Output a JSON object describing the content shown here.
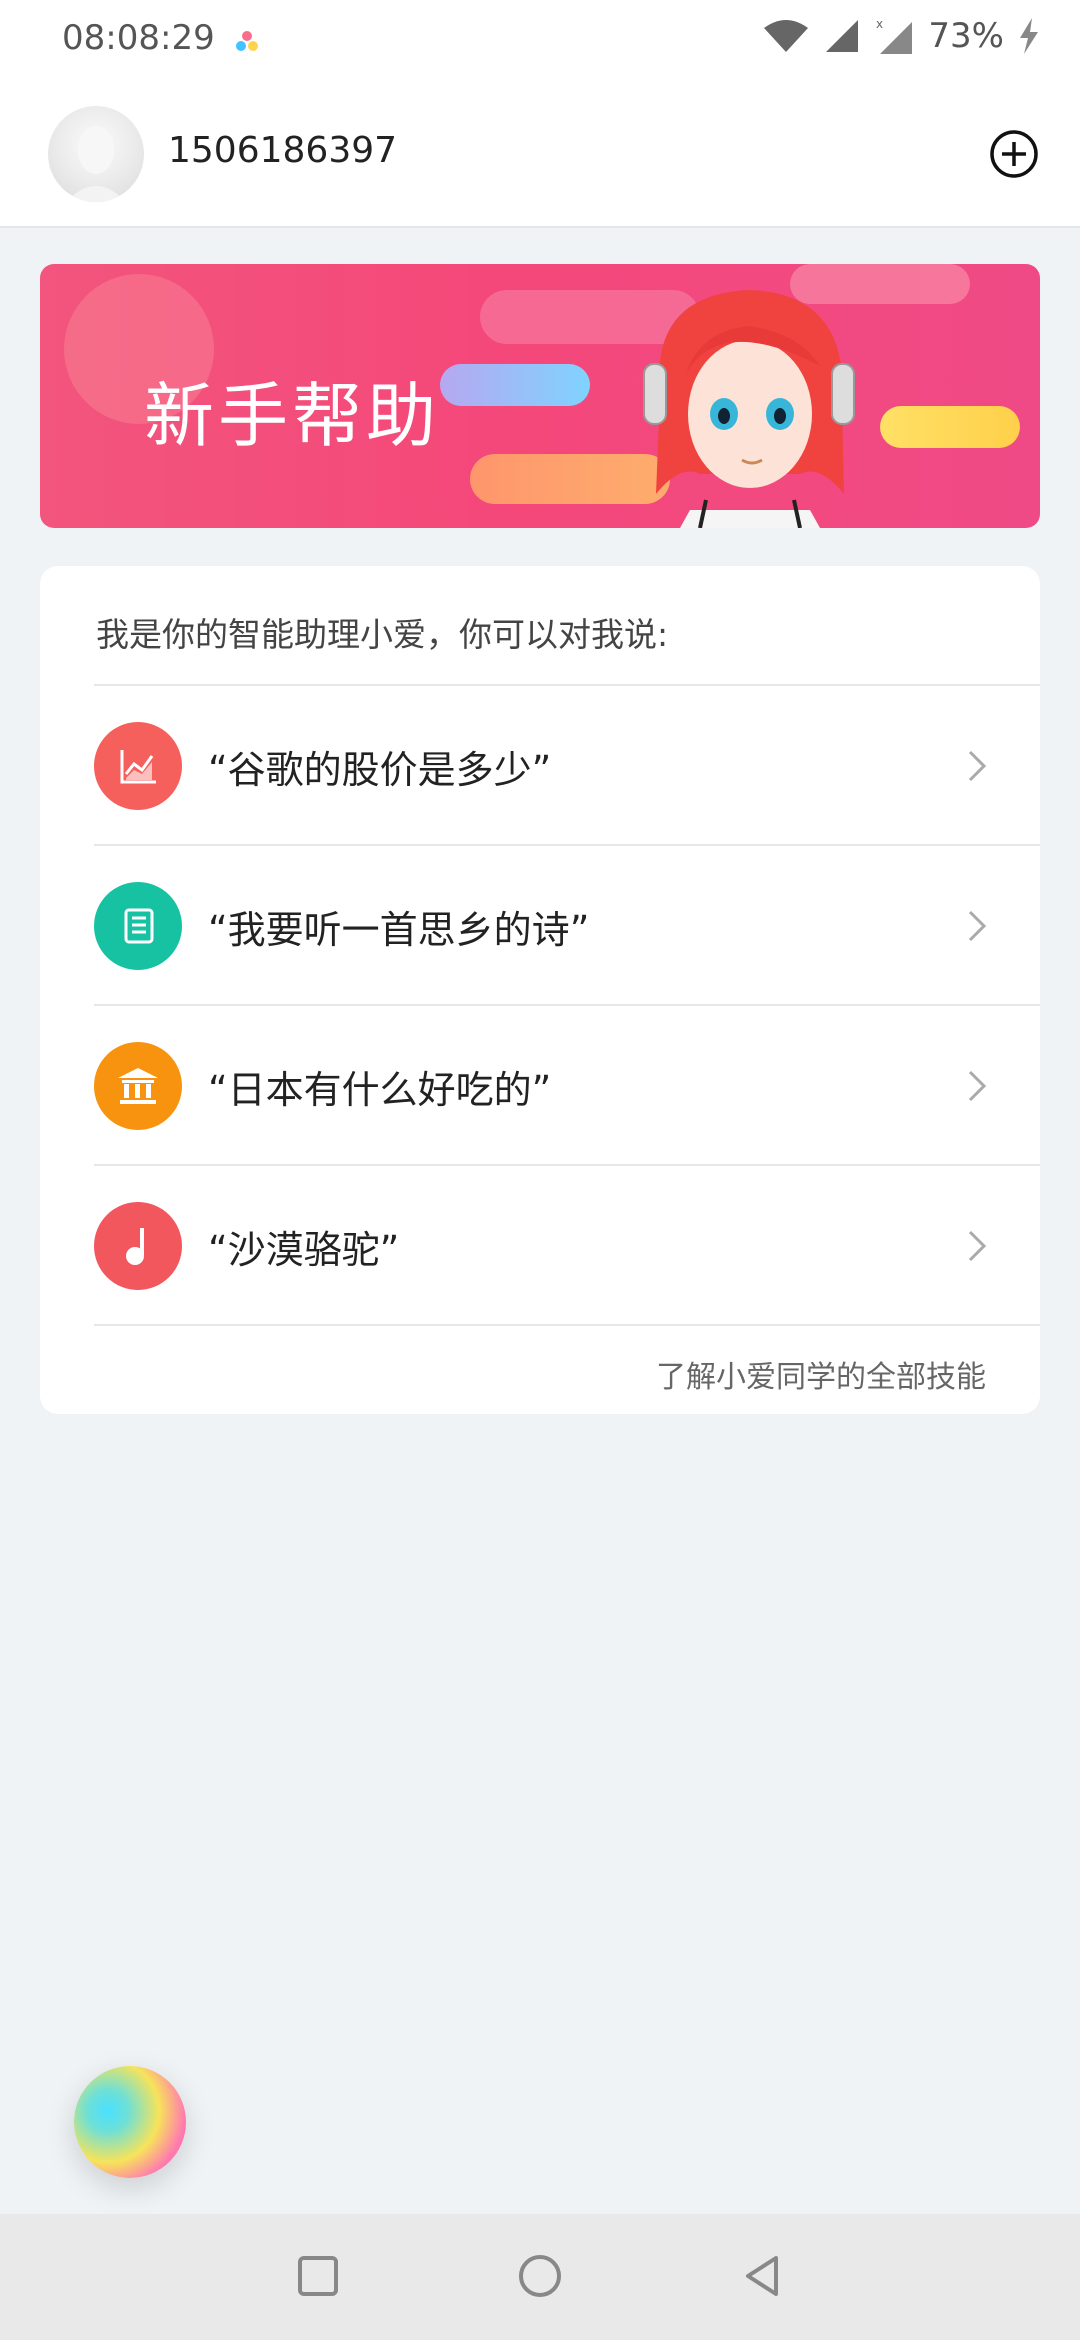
{
  "status_bar": {
    "time": "08:08:29",
    "battery": "73%"
  },
  "header": {
    "username": "1506186397"
  },
  "banner": {
    "title": "新手帮助"
  },
  "card": {
    "intro": "我是你的智能助理小爱，你可以对我说:",
    "items": [
      {
        "label": "“谷歌的股价是多少”",
        "icon": "stock-chart-icon",
        "color": "#f6605c"
      },
      {
        "label": "“我要听一首思乡的诗”",
        "icon": "book-icon",
        "color": "#17c2a3"
      },
      {
        "label": "“日本有什么好吃的”",
        "icon": "museum-icon",
        "color": "#f7930f"
      },
      {
        "label": "“沙漠骆驼”",
        "icon": "music-note-icon",
        "color": "#f2575e"
      }
    ],
    "footer_link": "了解小爱同学的全部技能"
  },
  "colors": {
    "banner": "#f4487a",
    "background": "#eff3f6"
  }
}
